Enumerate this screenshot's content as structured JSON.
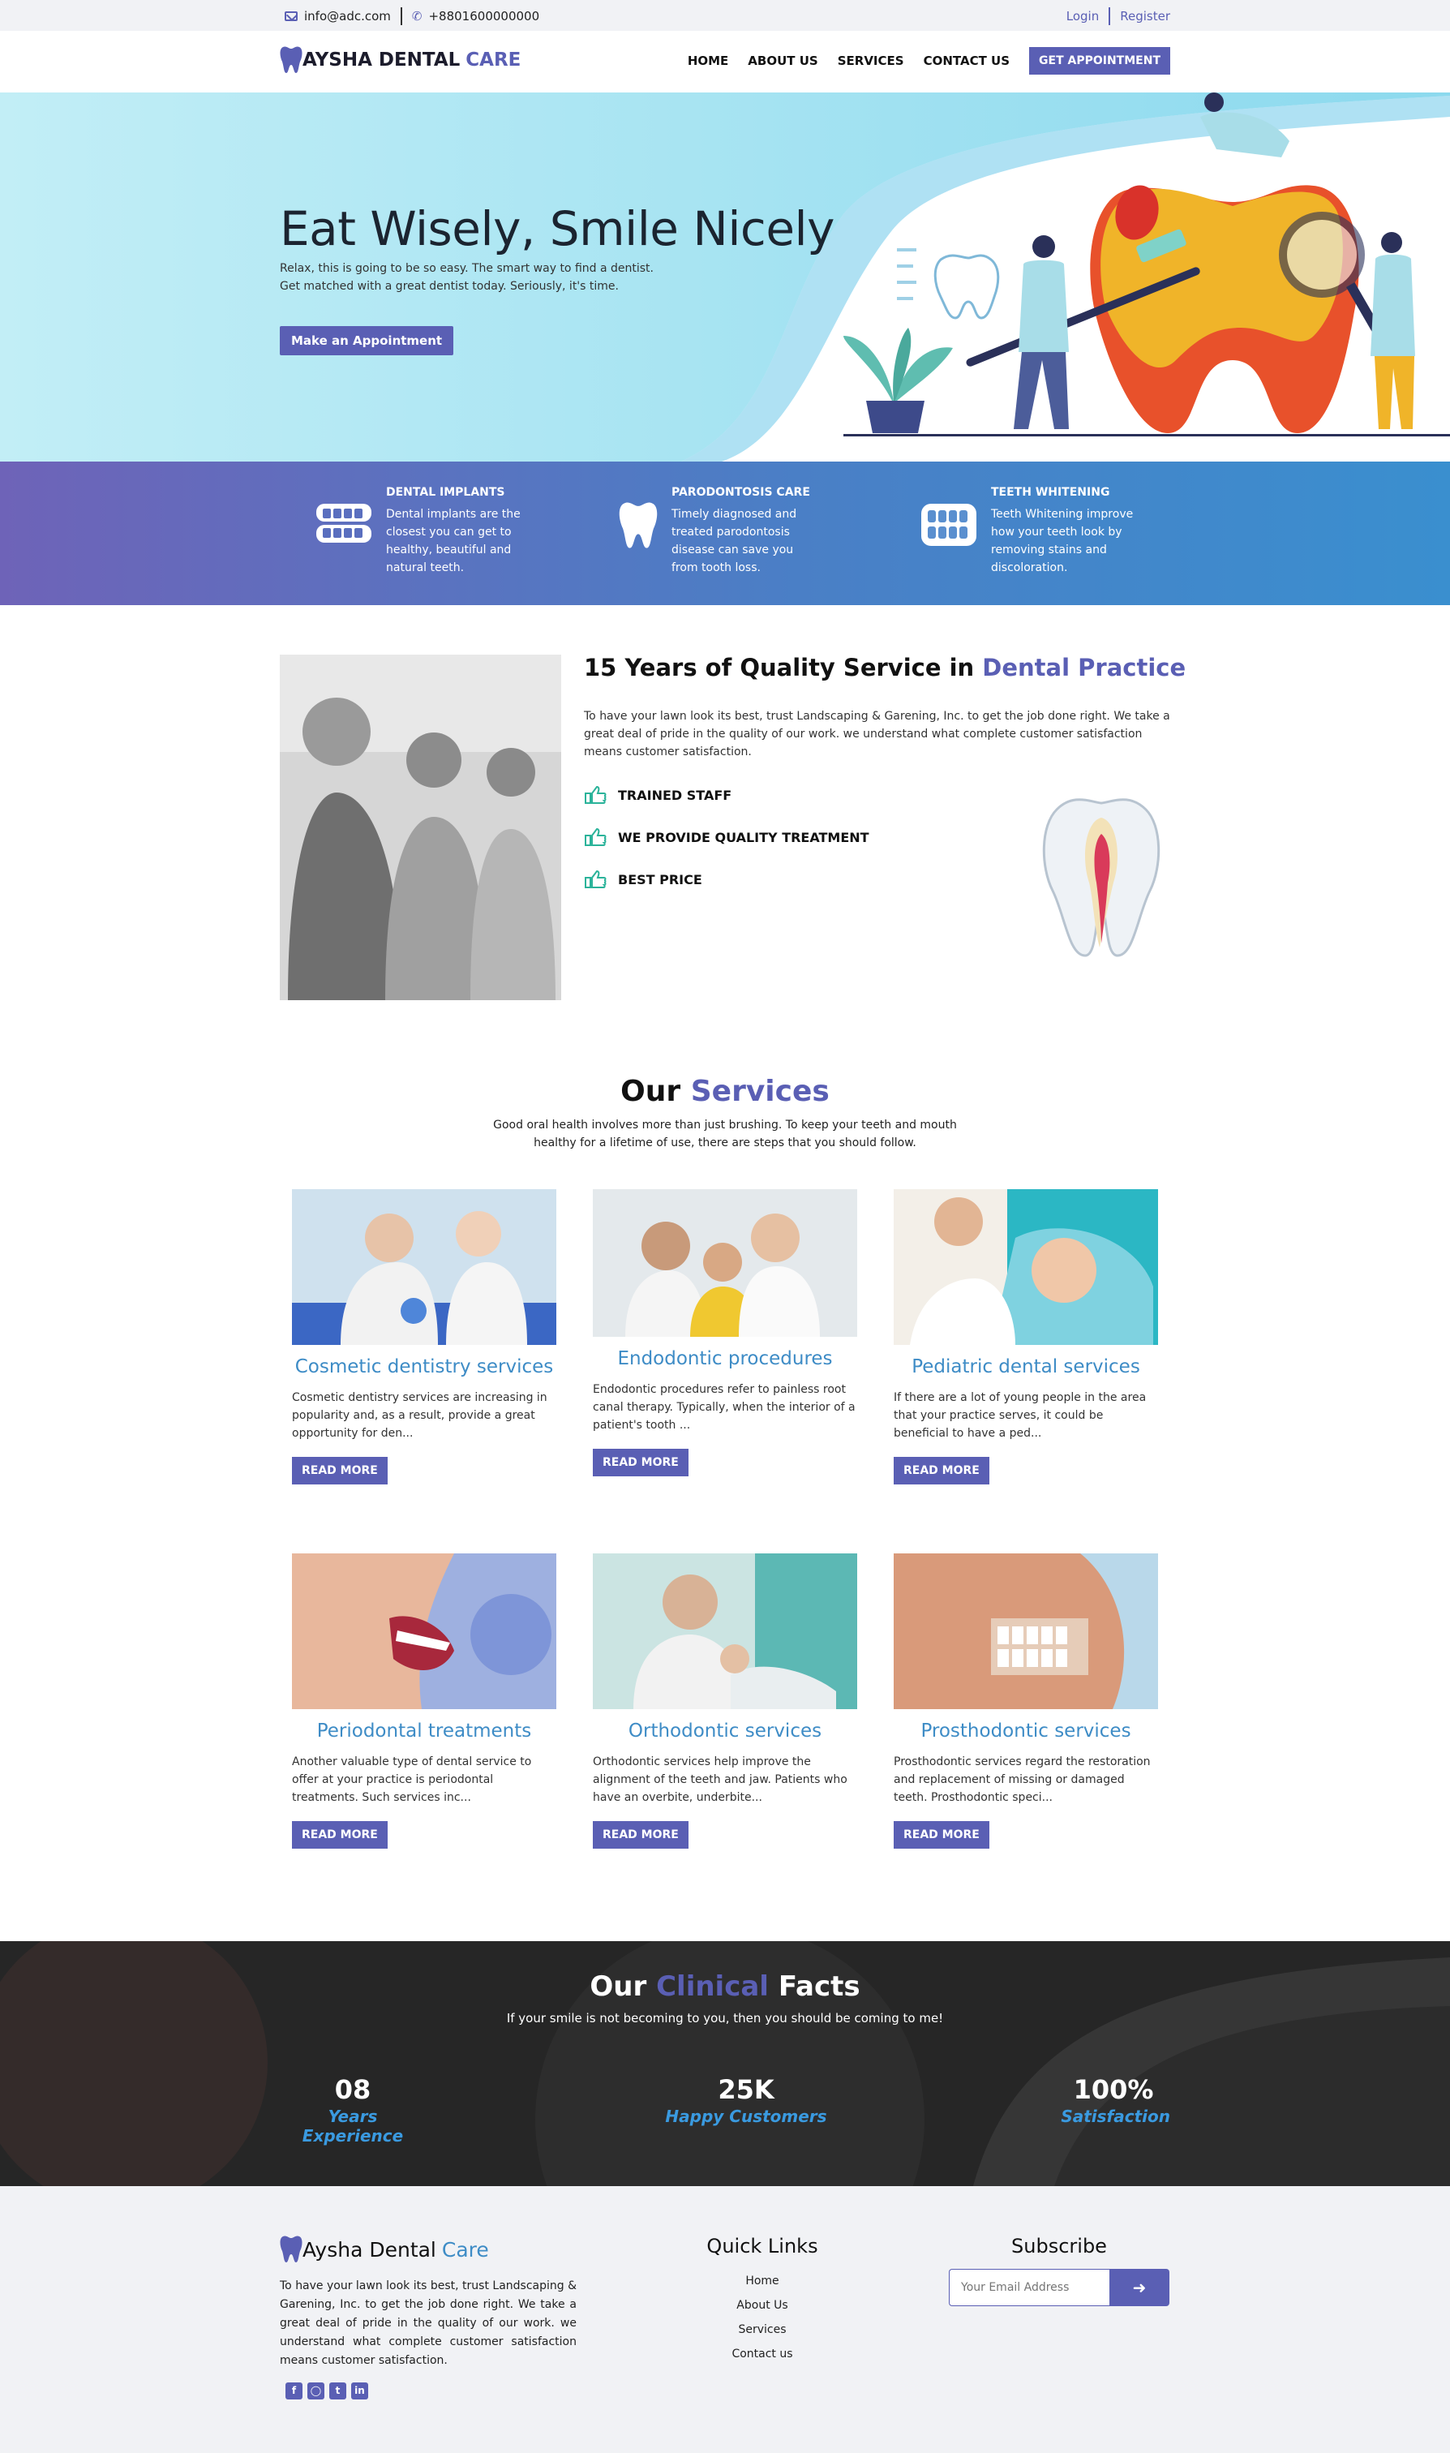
{
  "topbar": {
    "email": "info@adc.com",
    "phone": "+8801600000000",
    "login": "Login",
    "register": "Register"
  },
  "nav": {
    "brand_main": "AYSHA DENTAL",
    "brand_accent": "CARE",
    "items": [
      "HOME",
      "ABOUT US",
      "SERVICES",
      "CONTACT US"
    ],
    "cta": "GET APPOINTMENT"
  },
  "hero": {
    "title": "Eat Wisely, Smile Nicely",
    "line1": "Relax, this is going to be so easy. The smart way to find a dentist.",
    "line2": "Get matched with a great dentist today. Seriously, it's time.",
    "button": "Make an Appointment"
  },
  "features": [
    {
      "title": "DENTAL IMPLANTS",
      "desc": "Dental implants are the closest you can get to healthy, beautiful and natural teeth."
    },
    {
      "title": "PARODONTOSIS CARE",
      "desc": "Timely diagnosed and treated parodontosis disease can save you from tooth loss."
    },
    {
      "title": "TEETH WHITENING",
      "desc": "Teeth Whitening improve how your teeth look by removing stains and discoloration."
    }
  ],
  "about": {
    "title_main": "15 Years of Quality Service in",
    "title_accent": "Dental Practice",
    "text": "To have your lawn look its best, trust Landscaping & Garening, Inc. to get the job done right. We take a great deal of pride in the quality of our work. we understand what complete customer satisfaction means customer satisfaction.",
    "points": [
      "TRAINED STAFF",
      "WE PROVIDE QUALITY TREATMENT",
      "BEST PRICE"
    ]
  },
  "services": {
    "title_main": "Our",
    "title_accent": "Services",
    "subtitle": "Good oral health involves more than just brushing. To keep your teeth and mouth healthy for a lifetime of use, there are steps that you should follow.",
    "read_more": "READ MORE",
    "items": [
      {
        "name": "Cosmetic dentistry services",
        "text": "Cosmetic dentistry services are increasing in popularity and, as a result, provide a great opportunity for den..."
      },
      {
        "name": "Endodontic procedures",
        "text": "Endodontic procedures refer to painless root canal therapy. Typically, when the interior of a patient's tooth ..."
      },
      {
        "name": "Pediatric dental services",
        "text": "If there are a lot of young people in the area that your practice serves, it could be beneficial to have a ped..."
      },
      {
        "name": "Periodontal treatments",
        "text": "Another valuable type of dental service to offer at your practice is periodontal treatments. Such services inc..."
      },
      {
        "name": "Orthodontic services",
        "text": "Orthodontic services help improve the alignment of the teeth and jaw. Patients who have an overbite, underbite..."
      },
      {
        "name": "Prosthodontic services",
        "text": "Prosthodontic services regard the restoration and replacement of missing or damaged teeth. Prosthodontic speci..."
      }
    ]
  },
  "facts": {
    "title_a": "Our",
    "title_accent": "Clinical",
    "title_b": "Facts",
    "subtitle": "If your smile is not becoming to you, then you should be coming to me!",
    "items": [
      {
        "num": "08",
        "label": "Years Experience"
      },
      {
        "num": "25K",
        "label": "Happy Customers"
      },
      {
        "num": "100%",
        "label": "Satisfaction"
      }
    ]
  },
  "footer": {
    "brand_main": "Aysha Dental",
    "brand_accent": "Care",
    "desc": "To have your lawn look its best, trust Landscaping & Garening, Inc. to get the job done right. We take a great deal of pride in the quality of our work. we understand what complete customer satisfaction means customer satisfaction.",
    "quick_title": "Quick Links",
    "links": [
      "Home",
      "About Us",
      "Services",
      "Contact us"
    ],
    "subscribe_title": "Subscribe",
    "email_placeholder": "Your Email Address"
  },
  "colors": {
    "accent": "#5a5fb4",
    "blue": "#3e8cc6",
    "green": "#2bb39a"
  }
}
